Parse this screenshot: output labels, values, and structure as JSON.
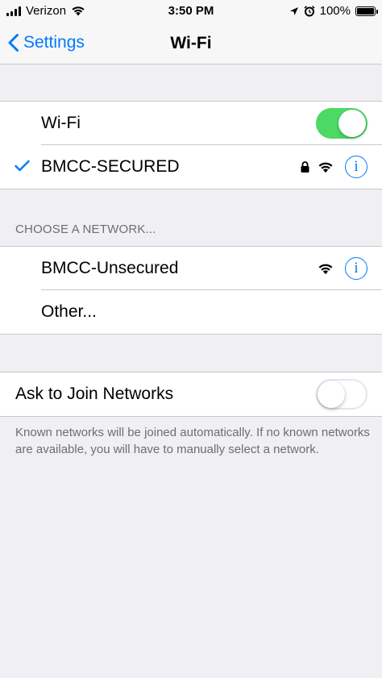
{
  "status_bar": {
    "carrier": "Verizon",
    "time": "3:50 PM",
    "battery": "100%",
    "icons": [
      "signal-bars-icon",
      "wifi-icon",
      "location-arrow-icon",
      "alarm-clock-icon",
      "battery-icon"
    ]
  },
  "nav": {
    "back_label": "Settings",
    "title": "Wi-Fi"
  },
  "wifi_group": {
    "wifi_label": "Wi-Fi",
    "wifi_on": true,
    "connected_network": "BMCC-SECURED"
  },
  "choose_section": {
    "header": "CHOOSE A NETWORK...",
    "networks": [
      {
        "name": "BMCC-Unsecured"
      }
    ],
    "other_label": "Other..."
  },
  "ask_group": {
    "label": "Ask to Join Networks",
    "on": false,
    "footer": "Known networks will be joined automatically. If no known networks are available, you will have to manually select a network."
  },
  "colors": {
    "accent": "#007aff",
    "toggle_on": "#4cd964",
    "background": "#efeff4",
    "secondary_text": "#6d6d72"
  }
}
